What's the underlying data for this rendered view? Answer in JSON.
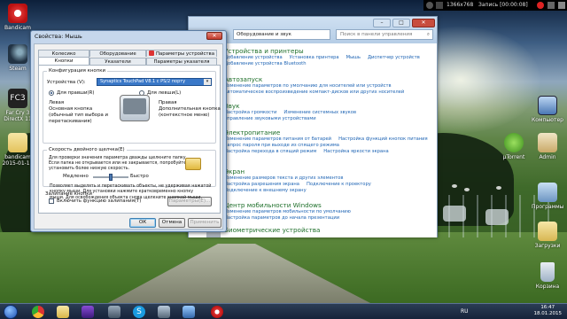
{
  "recorder": {
    "resolution": "1366x768",
    "record_label": "Запись [00:00:08]"
  },
  "desktop_icons": [
    {
      "label": "Bandicam"
    },
    {
      "label": "Steam"
    },
    {
      "label": "Far Cry 3 DirectX 11"
    },
    {
      "label": "bandicam 2015-01-18"
    },
    {
      "label": "Компьютер"
    },
    {
      "label": "µTorrent"
    },
    {
      "label": "Admin"
    },
    {
      "label": "Программы"
    },
    {
      "label": "Загрузки"
    },
    {
      "label": "Корзина"
    }
  ],
  "control_panel": {
    "address": "Оборудование и звук",
    "search_placeholder": "Поиск в панели управления",
    "categories": [
      {
        "title": "Устройства и принтеры",
        "links": [
          "Добавление устройства",
          "Установка принтера",
          "Мышь",
          "Диспетчер устройств",
          "Добавление устройства Bluetooth"
        ]
      },
      {
        "title": "Автозапуск",
        "links": [
          "Изменение параметров по умолчанию для носителей или устройств",
          "Автоматическое воспроизведение компакт-дисков или других носителей"
        ]
      },
      {
        "title": "Звук",
        "links": [
          "Настройка громкости",
          "Изменение системных звуков",
          "Управление звуковыми устройствами"
        ]
      },
      {
        "title": "Электропитание",
        "links": [
          "Изменение параметров питания от батарей",
          "Настройка функций кнопок питания",
          "Запрос пароля при выходе из спящего режима",
          "Настройка перехода в спящий режим",
          "Настройка яркости экрана"
        ]
      },
      {
        "title": "Экран",
        "links": [
          "Изменение размеров текста и других элементов",
          "Настройка разрешения экрана",
          "Подключение к проектору",
          "Подключение к внешнему экрану"
        ]
      },
      {
        "title": "Центр мобильности Windows",
        "links": [
          "Изменение параметров мобильности по умолчанию",
          "Настройка параметров до начала презентации"
        ]
      },
      {
        "title": "Биометрические устройства",
        "links": []
      }
    ]
  },
  "dialog": {
    "title": "Свойства: Мышь",
    "close": "✕",
    "tabs_row1": [
      "Колесико",
      "Оборудование",
      "Параметры устройства"
    ],
    "tabs_row2": [
      "Кнопки",
      "Указатели",
      "Параметры указателя"
    ],
    "config_group": "Конфигурация кнопки",
    "devices_label": "Устройства (V):",
    "device_value": "Synaptics TouchPad V8.1 с PS/2 порту",
    "right_handed": "Для правши(R)",
    "left_handed": "Для левши(L)",
    "left_title": "Левая",
    "left_desc": [
      "Основная кнопка",
      "(обычный тип выбора и",
      "перетаскивания)"
    ],
    "right_title": "Правая",
    "right_desc": [
      "Дополнительная кнопка",
      "(контекстное меню)"
    ],
    "dbl_group": "Скорость двойного щелчка(Е)",
    "dbl_text": [
      "Для проверки значения параметра дважды щелкните папку.",
      "Если папка не открывается или не закрывается, попробуйте",
      "установить более низкую скорость."
    ],
    "slow": "Медленно",
    "fast": "Быстро",
    "lock_group": "Залипание кнопки",
    "lock_check": "Включить функцию залипания(T)",
    "params_button": "Параметры(E)...",
    "lock_text": [
      "Позволяет выделять и перетаскивать объекты, не удерживая нажатой",
      "кнопку мыши. Для установки нажмите кратковременно кнопку",
      "мыши. Для освобождения объекта снова щелкните кнопкой мыши."
    ],
    "ok": "ОК",
    "cancel": "Отмена",
    "apply": "Применить"
  },
  "taskbar": {
    "lang": "RU",
    "time": "16:47",
    "date": "18.01.2015"
  }
}
